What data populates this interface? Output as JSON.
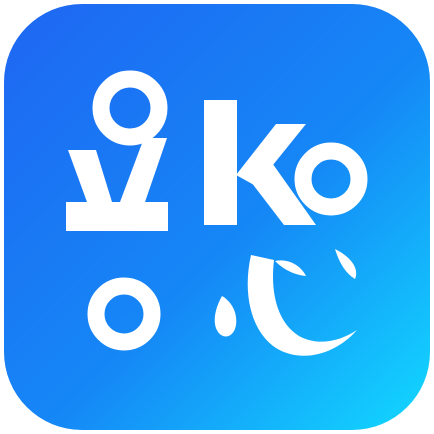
{
  "app_icon": {
    "name": "KoKo",
    "glyphs": [
      "K",
      "o",
      "K",
      "o"
    ],
    "logo_character": "心",
    "colors": {
      "gradient_start": "#1F66F2",
      "gradient_mid": "#1587F6",
      "gradient_end": "#12D9FF",
      "glyph": "#FFFFFF"
    }
  }
}
